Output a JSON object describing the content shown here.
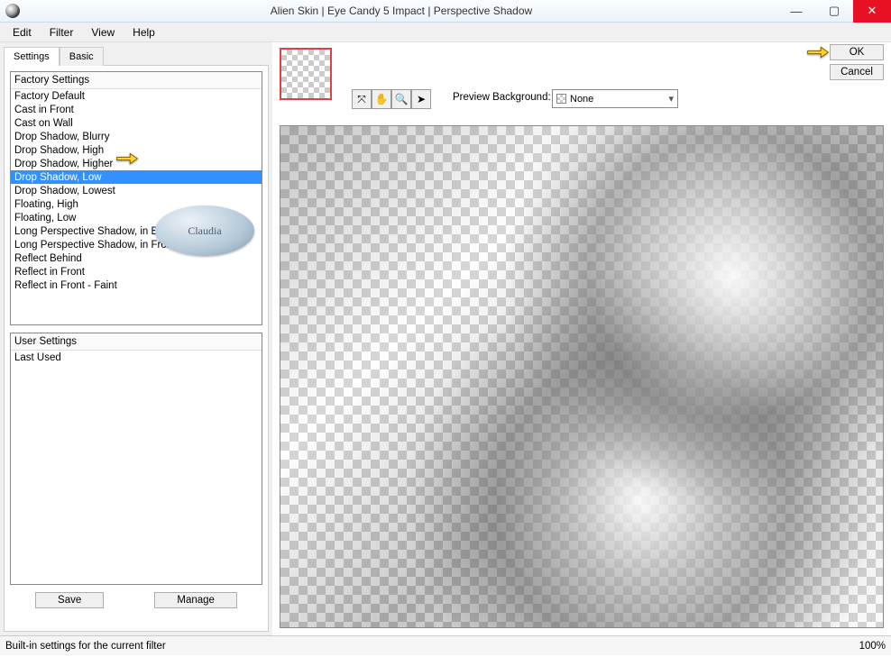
{
  "window": {
    "title": "Alien Skin | Eye Candy 5 Impact | Perspective Shadow",
    "controls": {
      "min": "—",
      "max": "▢",
      "close": "✕"
    }
  },
  "menubar": [
    "Edit",
    "Filter",
    "View",
    "Help"
  ],
  "tabs": {
    "settings": "Settings",
    "basic": "Basic"
  },
  "factory": {
    "header": "Factory Settings",
    "items": [
      "Factory Default",
      "Cast in Front",
      "Cast on Wall",
      "Drop Shadow, Blurry",
      "Drop Shadow, High",
      "Drop Shadow, Higher",
      "Drop Shadow, Low",
      "Drop Shadow, Lowest",
      "Floating, High",
      "Floating, Low",
      "Long Perspective Shadow, in Back",
      "Long Perspective Shadow, in Front",
      "Reflect Behind",
      "Reflect in Front",
      "Reflect in Front - Faint"
    ],
    "selected_index": 6
  },
  "user": {
    "header": "User Settings",
    "items": [
      "Last Used"
    ]
  },
  "buttons": {
    "save": "Save",
    "manage": "Manage",
    "ok": "OK",
    "cancel": "Cancel"
  },
  "preview_bg": {
    "label": "Preview Background:",
    "value": "None"
  },
  "tools": [
    "⤧",
    "✋",
    "🔍",
    "➤"
  ],
  "watermark": "Claudia",
  "status": {
    "left": "Built-in settings for the current filter",
    "zoom": "100%"
  }
}
